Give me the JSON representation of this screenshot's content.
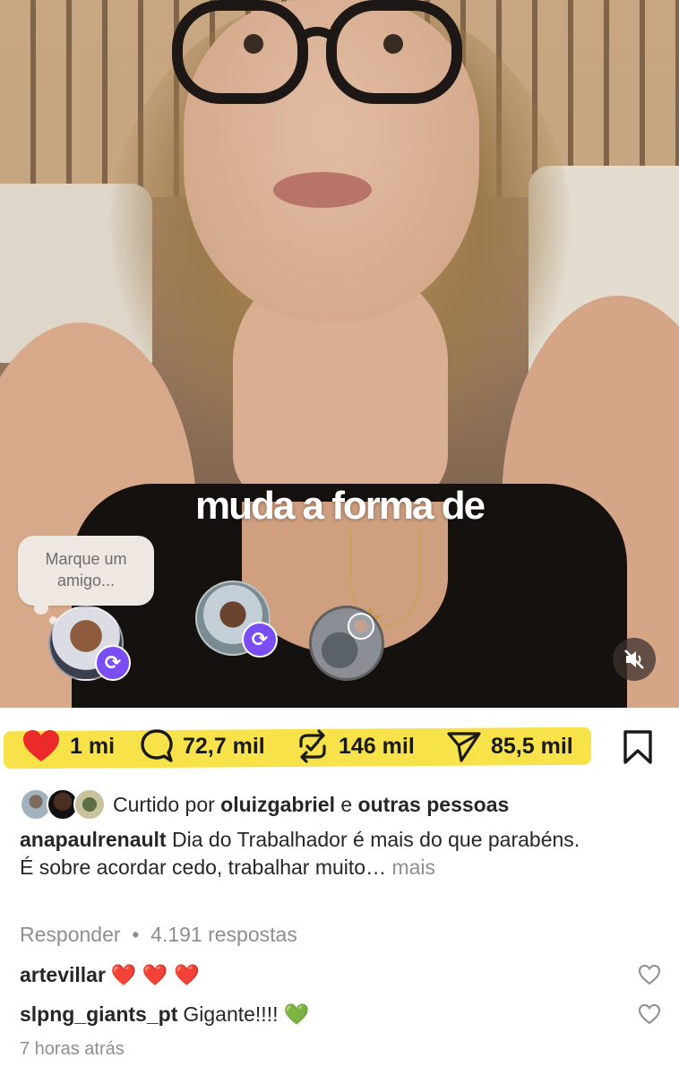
{
  "video": {
    "caption": "muda a forma de",
    "tag_prompt": "Marque um amigo...",
    "mute_icon": "speaker-muted-icon"
  },
  "actions": {
    "like_count": "1 mi",
    "comment_count": "72,7 mil",
    "repost_count": "146 mil",
    "share_count": "85,5 mil"
  },
  "colors": {
    "like_red": "#ed2a2a",
    "highlight_yellow": "#f8e24a",
    "repost_purple": "#7b4df5",
    "muted_gray": "#8e8e8e"
  },
  "liked_by": {
    "prefix": "Curtido por",
    "user": "oluizgabriel",
    "connector": "e",
    "others": "outras pessoas"
  },
  "post": {
    "author": "anapaulrenault",
    "text_line1": "Dia do Trabalhador é mais do que parabéns.",
    "text_line2": "É sobre acordar cedo, trabalhar muito…",
    "more_label": "mais"
  },
  "replies": {
    "reply_label": "Responder",
    "separator": "•",
    "count_label": "4.191 respostas"
  },
  "comments": [
    {
      "user": "artevillar",
      "text": "❤️ ❤️ ❤️"
    },
    {
      "user": "slpng_giants_pt",
      "text": "Gigante!!!! 💚"
    }
  ],
  "timestamp": "7 horas atrás"
}
